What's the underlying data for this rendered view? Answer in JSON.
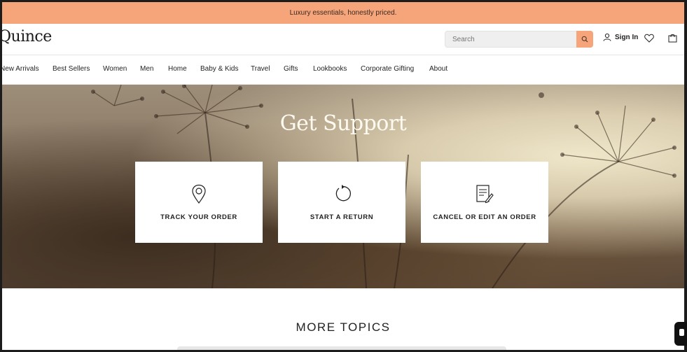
{
  "announcement": "Luxury essentials, honestly priced.",
  "header": {
    "logo": "Quince",
    "search_placeholder": "Search",
    "sign_in": "Sign In"
  },
  "nav": [
    "New Arrivals",
    "Best Sellers",
    "Women",
    "Men",
    "Home",
    "Baby & Kids",
    "Travel",
    "Gifts",
    "Lookbooks",
    "Corporate Gifting",
    "About"
  ],
  "hero": {
    "title": "Get Support",
    "cards": [
      {
        "label": "TRACK YOUR ORDER",
        "icon": "location-pin-icon"
      },
      {
        "label": "START A RETURN",
        "icon": "return-arrow-icon"
      },
      {
        "label": "CANCEL OR EDIT AN ORDER",
        "icon": "edit-document-icon"
      }
    ]
  },
  "more_topics": "MORE TOPICS",
  "colors": {
    "accent": "#f6a47a"
  }
}
